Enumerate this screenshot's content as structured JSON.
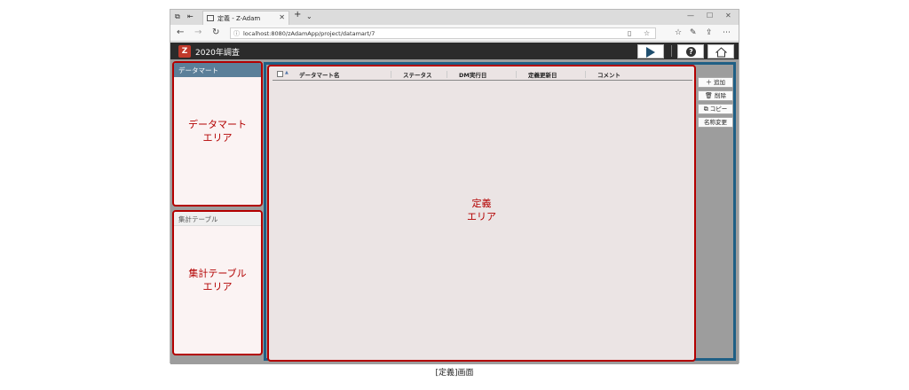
{
  "browser": {
    "tab_title": "定義 - Z-Adam",
    "url": "localhost:8080/zAdamApp/project/datamart/7"
  },
  "app": {
    "title": "2020年調査"
  },
  "panels": {
    "datamart_header": "データマート",
    "datamart_area_line1": "データマート",
    "datamart_area_line2": "エリア",
    "table_header": "集計テーブル",
    "table_area_line1": "集計テーブル",
    "table_area_line2": "エリア"
  },
  "grid": {
    "columns": [
      "データマート名",
      "ステータス",
      "DM実行日",
      "定義更新日",
      "コメント"
    ]
  },
  "definition_area": {
    "line1": "定義",
    "line2": "エリア"
  },
  "actions": {
    "add": "追加",
    "delete": "削除",
    "copy": "コピー",
    "rename": "名称変更"
  },
  "caption": "[定義]画面"
}
